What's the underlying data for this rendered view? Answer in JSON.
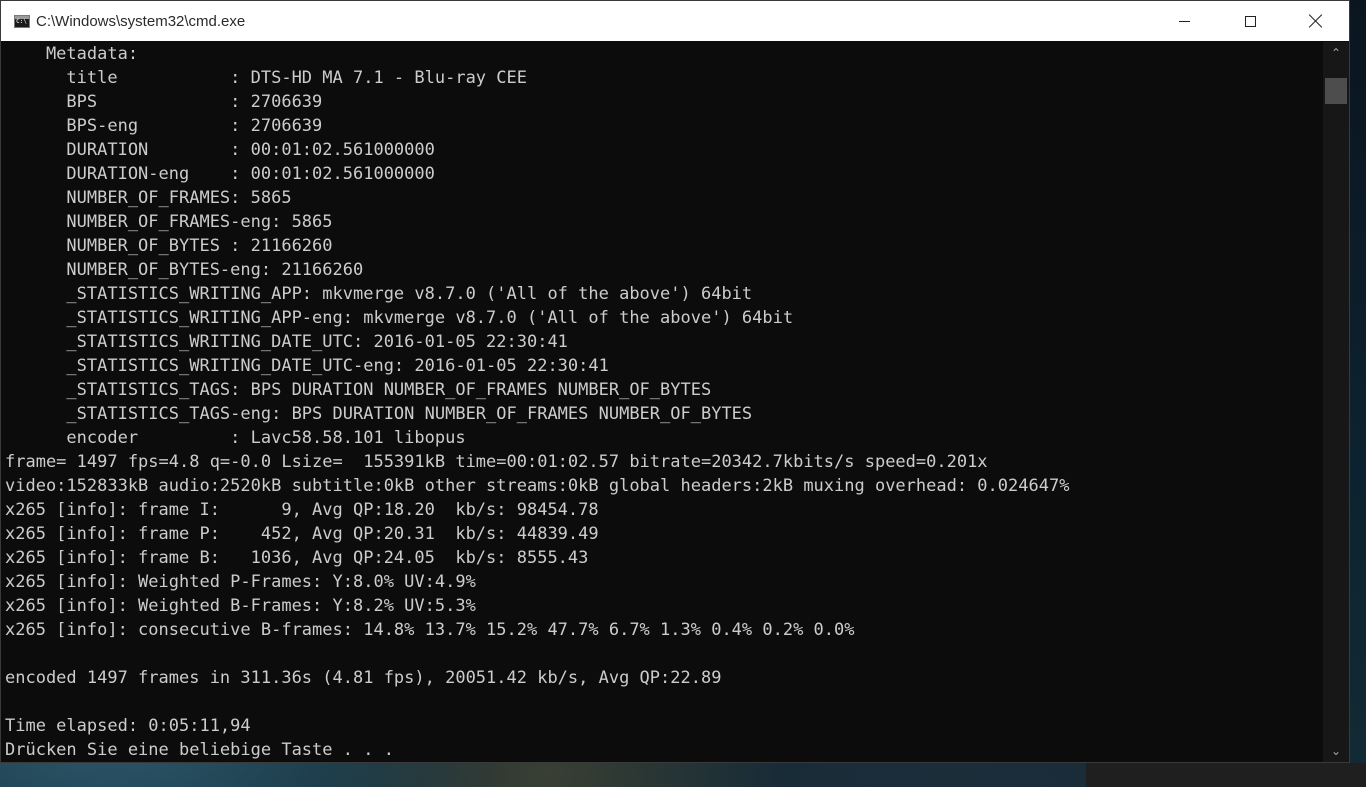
{
  "window": {
    "title": "C:\\Windows\\system32\\cmd.exe",
    "icon": "cmd-icon",
    "controls": {
      "minimize_icon": "minimize-icon",
      "maximize_icon": "maximize-icon",
      "close_icon": "close-icon"
    }
  },
  "console": {
    "lines": [
      "    Metadata:",
      "      title           : DTS-HD MA 7.1 - Blu-ray CEE",
      "      BPS             : 2706639",
      "      BPS-eng         : 2706639",
      "      DURATION        : 00:01:02.561000000",
      "      DURATION-eng    : 00:01:02.561000000",
      "      NUMBER_OF_FRAMES: 5865",
      "      NUMBER_OF_FRAMES-eng: 5865",
      "      NUMBER_OF_BYTES : 21166260",
      "      NUMBER_OF_BYTES-eng: 21166260",
      "      _STATISTICS_WRITING_APP: mkvmerge v8.7.0 ('All of the above') 64bit",
      "      _STATISTICS_WRITING_APP-eng: mkvmerge v8.7.0 ('All of the above') 64bit",
      "      _STATISTICS_WRITING_DATE_UTC: 2016-01-05 22:30:41",
      "      _STATISTICS_WRITING_DATE_UTC-eng: 2016-01-05 22:30:41",
      "      _STATISTICS_TAGS: BPS DURATION NUMBER_OF_FRAMES NUMBER_OF_BYTES",
      "      _STATISTICS_TAGS-eng: BPS DURATION NUMBER_OF_FRAMES NUMBER_OF_BYTES",
      "      encoder         : Lavc58.58.101 libopus",
      "frame= 1497 fps=4.8 q=-0.0 Lsize=  155391kB time=00:01:02.57 bitrate=20342.7kbits/s speed=0.201x",
      "video:152833kB audio:2520kB subtitle:0kB other streams:0kB global headers:2kB muxing overhead: 0.024647%",
      "x265 [info]: frame I:      9, Avg QP:18.20  kb/s: 98454.78",
      "x265 [info]: frame P:    452, Avg QP:20.31  kb/s: 44839.49",
      "x265 [info]: frame B:   1036, Avg QP:24.05  kb/s: 8555.43",
      "x265 [info]: Weighted P-Frames: Y:8.0% UV:4.9%",
      "x265 [info]: Weighted B-Frames: Y:8.2% UV:5.3%",
      "x265 [info]: consecutive B-frames: 14.8% 13.7% 15.2% 47.7% 6.7% 1.3% 0.4% 0.2% 0.0%",
      "",
      "encoded 1497 frames in 311.36s (4.81 fps), 20051.42 kb/s, Avg QP:22.89",
      "",
      "Time elapsed: 0:05:11,94",
      "Drücken Sie eine beliebige Taste . . ."
    ]
  },
  "scrollbar": {
    "up_icon": "scroll-up-arrow-icon",
    "down_icon": "scroll-down-arrow-icon",
    "up_glyph": "⌃",
    "down_glyph": "⌄"
  }
}
